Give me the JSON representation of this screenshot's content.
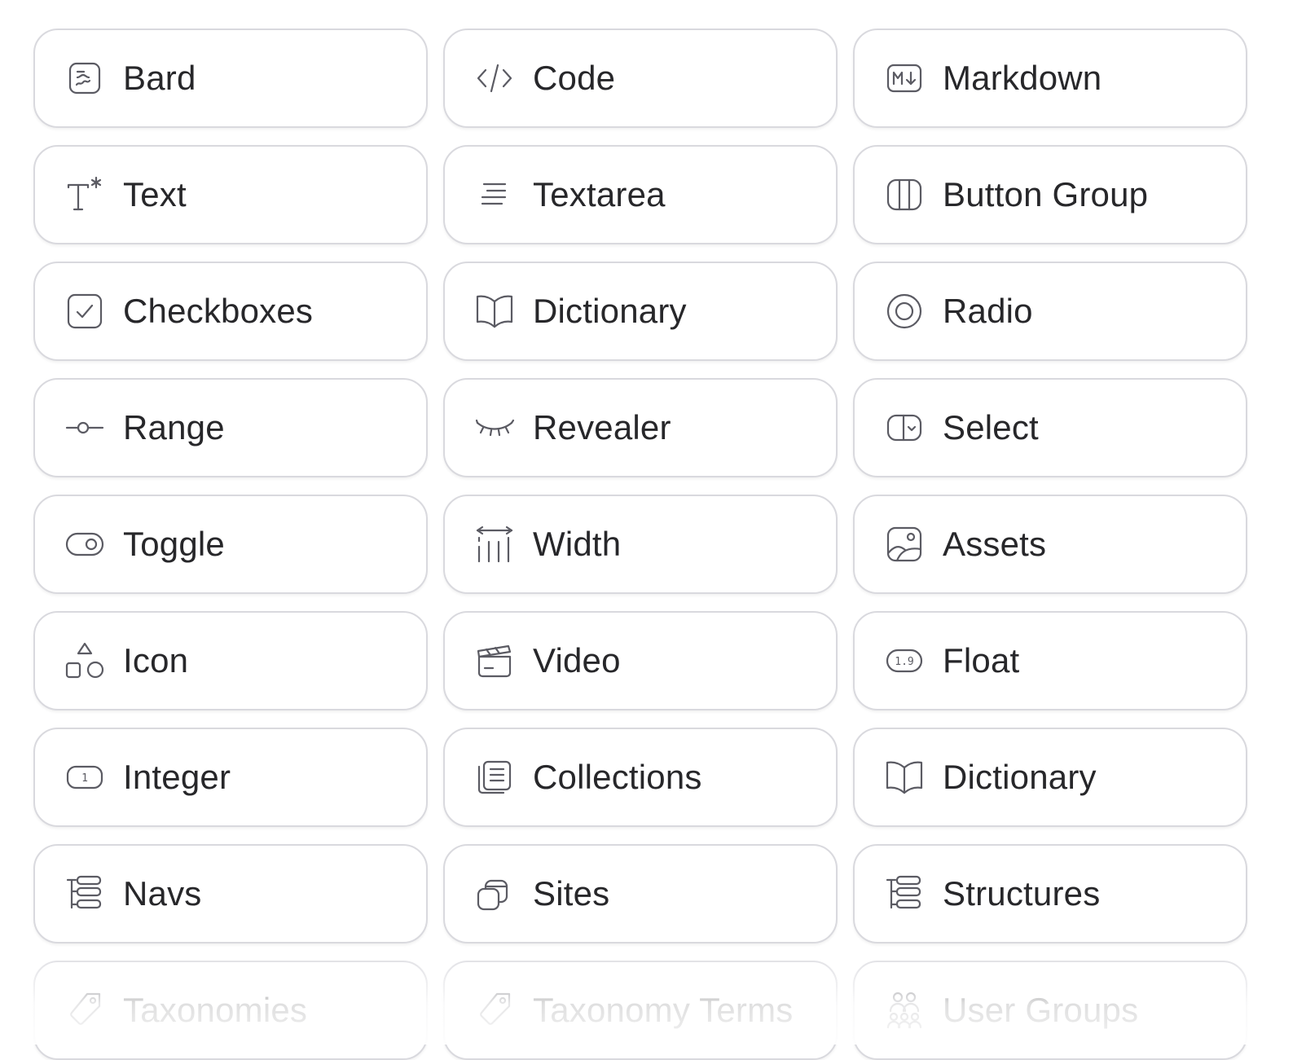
{
  "fieldtypes": [
    {
      "label": "Bard",
      "icon": "bard-icon"
    },
    {
      "label": "Code",
      "icon": "code-icon"
    },
    {
      "label": "Markdown",
      "icon": "markdown-icon"
    },
    {
      "label": "Text",
      "icon": "text-icon"
    },
    {
      "label": "Textarea",
      "icon": "textarea-icon"
    },
    {
      "label": "Button Group",
      "icon": "button-group-icon"
    },
    {
      "label": "Checkboxes",
      "icon": "checkbox-icon"
    },
    {
      "label": "Dictionary",
      "icon": "book-icon"
    },
    {
      "label": "Radio",
      "icon": "radio-icon"
    },
    {
      "label": "Range",
      "icon": "range-icon"
    },
    {
      "label": "Revealer",
      "icon": "eye-closed-icon"
    },
    {
      "label": "Select",
      "icon": "select-icon"
    },
    {
      "label": "Toggle",
      "icon": "toggle-icon"
    },
    {
      "label": "Width",
      "icon": "width-icon"
    },
    {
      "label": "Assets",
      "icon": "assets-icon"
    },
    {
      "label": "Icon",
      "icon": "shapes-icon"
    },
    {
      "label": "Video",
      "icon": "clapperboard-icon"
    },
    {
      "label": "Float",
      "icon": "float-icon"
    },
    {
      "label": "Integer",
      "icon": "integer-icon"
    },
    {
      "label": "Collections",
      "icon": "collections-icon"
    },
    {
      "label": "Dictionary",
      "icon": "book-icon"
    },
    {
      "label": "Navs",
      "icon": "tree-icon"
    },
    {
      "label": "Sites",
      "icon": "sites-icon"
    },
    {
      "label": "Structures",
      "icon": "tree-icon"
    },
    {
      "label": "Taxonomies",
      "icon": "tag-icon"
    },
    {
      "label": "Taxonomy Terms",
      "icon": "tag-icon"
    },
    {
      "label": "User Groups",
      "icon": "user-groups-icon"
    }
  ],
  "colors": {
    "border": "#d9d9de",
    "icon": "#5b5b63",
    "text": "#27272a",
    "background": "#ffffff"
  }
}
